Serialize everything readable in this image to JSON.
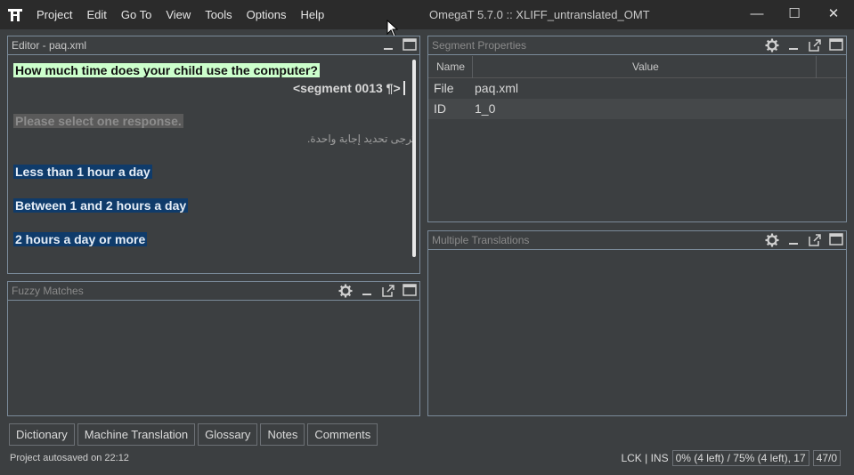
{
  "titlebar": {
    "menu": [
      "Project",
      "Edit",
      "Go To",
      "View",
      "Tools",
      "Options",
      "Help"
    ],
    "title": "OmegaT 5.7.0 :: XLIFF_untranslated_OMT",
    "minimize": "—",
    "maximize": "☐",
    "close": "✕"
  },
  "editor": {
    "title": "Editor - paq.xml",
    "active_segment": "How much time does your child use the computer?",
    "segment_marker": "<segment 0013 ¶>",
    "untranslated_source": "Please select one response.",
    "rtl_translation": "يُرجى تحديد إجابة واحدة.",
    "options": [
      "Less than 1 hour a day",
      "Between 1 and 2 hours a day",
      "2 hours a day or more"
    ]
  },
  "segment_properties": {
    "title": "Segment Properties",
    "columns": [
      "Name",
      "Value"
    ],
    "rows": [
      {
        "name": "File",
        "value": "paq.xml"
      },
      {
        "name": "ID",
        "value": "1_0"
      }
    ]
  },
  "fuzzy_matches": {
    "title": "Fuzzy Matches"
  },
  "multiple_translations": {
    "title": "Multiple Translations"
  },
  "tabs": [
    "Dictionary",
    "Machine Translation",
    "Glossary",
    "Notes",
    "Comments"
  ],
  "status": {
    "autosave": "Project autosaved on 22:12",
    "mode": "LCK | INS",
    "progress": "0% (4 left) / 75% (4 left), 17",
    "count": "47/0"
  },
  "icons": [
    "app-logo-icon",
    "gear-icon",
    "minimize-pane-icon",
    "undock-icon",
    "maximize-pane-icon"
  ]
}
